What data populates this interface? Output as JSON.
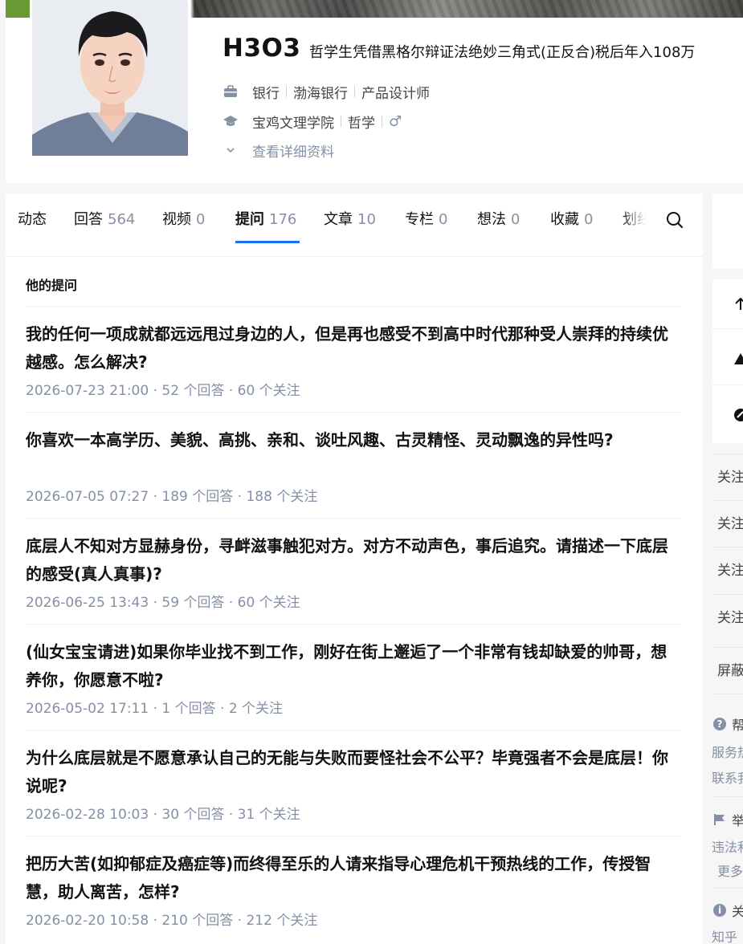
{
  "profile": {
    "name": "H3O3",
    "headline": "哲学生凭借黑格尔辩证法绝妙三角式(正反合)税后年入108万",
    "work": {
      "industry": "银行",
      "company": "渤海银行",
      "position": "产品设计师"
    },
    "education": {
      "school": "宝鸡文理学院",
      "major": "哲学",
      "gender": "♂"
    },
    "view_more": "查看详细资料"
  },
  "tabs": [
    {
      "label": "动态",
      "count": ""
    },
    {
      "label": "回答",
      "count": "564"
    },
    {
      "label": "视频",
      "count": "0"
    },
    {
      "label": "提问",
      "count": "176"
    },
    {
      "label": "文章",
      "count": "10"
    },
    {
      "label": "专栏",
      "count": "0"
    },
    {
      "label": "想法",
      "count": "0"
    },
    {
      "label": "收藏",
      "count": "0"
    },
    {
      "label": "划线",
      "count": ""
    }
  ],
  "active_tab": "提问",
  "section_title": "他的提问",
  "questions": [
    {
      "title": "我的任何一项成就都远远甩过身边的人，但是再也感受不到高中时代那种受人崇拜的持续优越感。怎么解决?",
      "meta": "2026-07-23 21:00 · 52 个回答 · 60 个关注"
    },
    {
      "title": "你喜欢一本高学历、美貌、高挑、亲和、谈吐风趣、古灵精怪、灵动飘逸的异性吗?",
      "meta": "2026-07-05 07:27 · 189 个回答 · 188 个关注"
    },
    {
      "title": "底层人不知对方显赫身份，寻衅滋事触犯对方。对方不动声色，事后追究。请描述一下底层的感受(真人真事)?",
      "meta": "2026-06-25 13:43 · 59 个回答 · 60 个关注"
    },
    {
      "title": "(仙女宝宝请进)如果你毕业找不到工作，刚好在街上邂逅了一个非常有钱却缺爱的帅哥，想养你，你愿意不啦?",
      "meta": "2026-05-02 17:11 · 1 个回答 · 2 个关注"
    },
    {
      "title": "为什么底层就是不愿意承认自己的无能与失败而要怪社会不公平？毕竟强者不会是底层！你说呢?",
      "meta": "2026-02-28 10:03 · 30 个回答 · 31 个关注"
    },
    {
      "title": "把历大苦(如抑郁症及癌症等)而终得至乐的人请来指导心理危机干预热线的工作，传授智慧，助人离苦，怎样?",
      "meta": "2026-02-20 10:58 · 210 个回答 · 212 个关注"
    }
  ],
  "sidebar": {
    "follow_items": [
      "关注",
      "关注",
      "关注",
      "关注"
    ],
    "block": "屏蔽",
    "help_head": "帮",
    "help_lines": [
      "服务热",
      "联系我"
    ],
    "report_head": "举",
    "report_lines": [
      "违法和",
      "更多"
    ],
    "about_head": "关",
    "about_lines": [
      "知乎"
    ]
  }
}
